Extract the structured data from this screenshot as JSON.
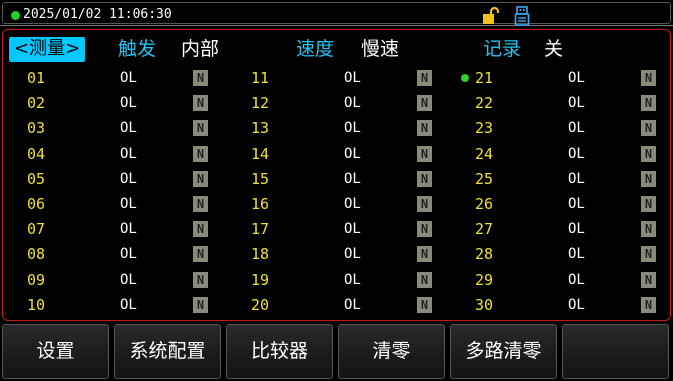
{
  "status_bar": {
    "datetime": "2025/01/02  11:06:30",
    "icons": [
      "status-led",
      "lock-icon",
      "usb-icon"
    ]
  },
  "header": {
    "mode_tab": "<测量>",
    "trigger_label": "触发",
    "trigger_value": "内部",
    "speed_label": "速度",
    "speed_value": "慢速",
    "record_label": "记录",
    "record_value": "关"
  },
  "channels": {
    "col1": [
      {
        "no": "01",
        "value": "OL",
        "flag": "N"
      },
      {
        "no": "02",
        "value": "OL",
        "flag": "N"
      },
      {
        "no": "03",
        "value": "OL",
        "flag": "N"
      },
      {
        "no": "04",
        "value": "OL",
        "flag": "N"
      },
      {
        "no": "05",
        "value": "OL",
        "flag": "N"
      },
      {
        "no": "06",
        "value": "OL",
        "flag": "N"
      },
      {
        "no": "07",
        "value": "OL",
        "flag": "N"
      },
      {
        "no": "08",
        "value": "OL",
        "flag": "N"
      },
      {
        "no": "09",
        "value": "OL",
        "flag": "N"
      },
      {
        "no": "10",
        "value": "OL",
        "flag": "N"
      }
    ],
    "col2": [
      {
        "no": "11",
        "value": "OL",
        "flag": "N"
      },
      {
        "no": "12",
        "value": "OL",
        "flag": "N"
      },
      {
        "no": "13",
        "value": "OL",
        "flag": "N"
      },
      {
        "no": "14",
        "value": "OL",
        "flag": "N"
      },
      {
        "no": "15",
        "value": "OL",
        "flag": "N"
      },
      {
        "no": "16",
        "value": "OL",
        "flag": "N"
      },
      {
        "no": "17",
        "value": "OL",
        "flag": "N"
      },
      {
        "no": "18",
        "value": "OL",
        "flag": "N"
      },
      {
        "no": "19",
        "value": "OL",
        "flag": "N"
      },
      {
        "no": "20",
        "value": "OL",
        "flag": "N"
      }
    ],
    "col3": [
      {
        "no": "21",
        "value": "OL",
        "flag": "N"
      },
      {
        "no": "22",
        "value": "OL",
        "flag": "N"
      },
      {
        "no": "23",
        "value": "OL",
        "flag": "N"
      },
      {
        "no": "24",
        "value": "OL",
        "flag": "N"
      },
      {
        "no": "25",
        "value": "OL",
        "flag": "N"
      },
      {
        "no": "26",
        "value": "OL",
        "flag": "N"
      },
      {
        "no": "27",
        "value": "OL",
        "flag": "N"
      },
      {
        "no": "28",
        "value": "OL",
        "flag": "N"
      },
      {
        "no": "29",
        "value": "OL",
        "flag": "N"
      },
      {
        "no": "30",
        "value": "OL",
        "flag": "N"
      }
    ],
    "active_channel": "21"
  },
  "softkeys": [
    "设置",
    "系统配置",
    "比较器",
    "清零",
    "多路清零",
    ""
  ],
  "colors": {
    "accent_cyan": "#00c8ff",
    "channel_number": "#f0e030",
    "panel_border": "#c21818",
    "active_indicator": "#2ed02e",
    "lock_icon": "#f0c020",
    "usb_icon": "#3aa8f0"
  }
}
